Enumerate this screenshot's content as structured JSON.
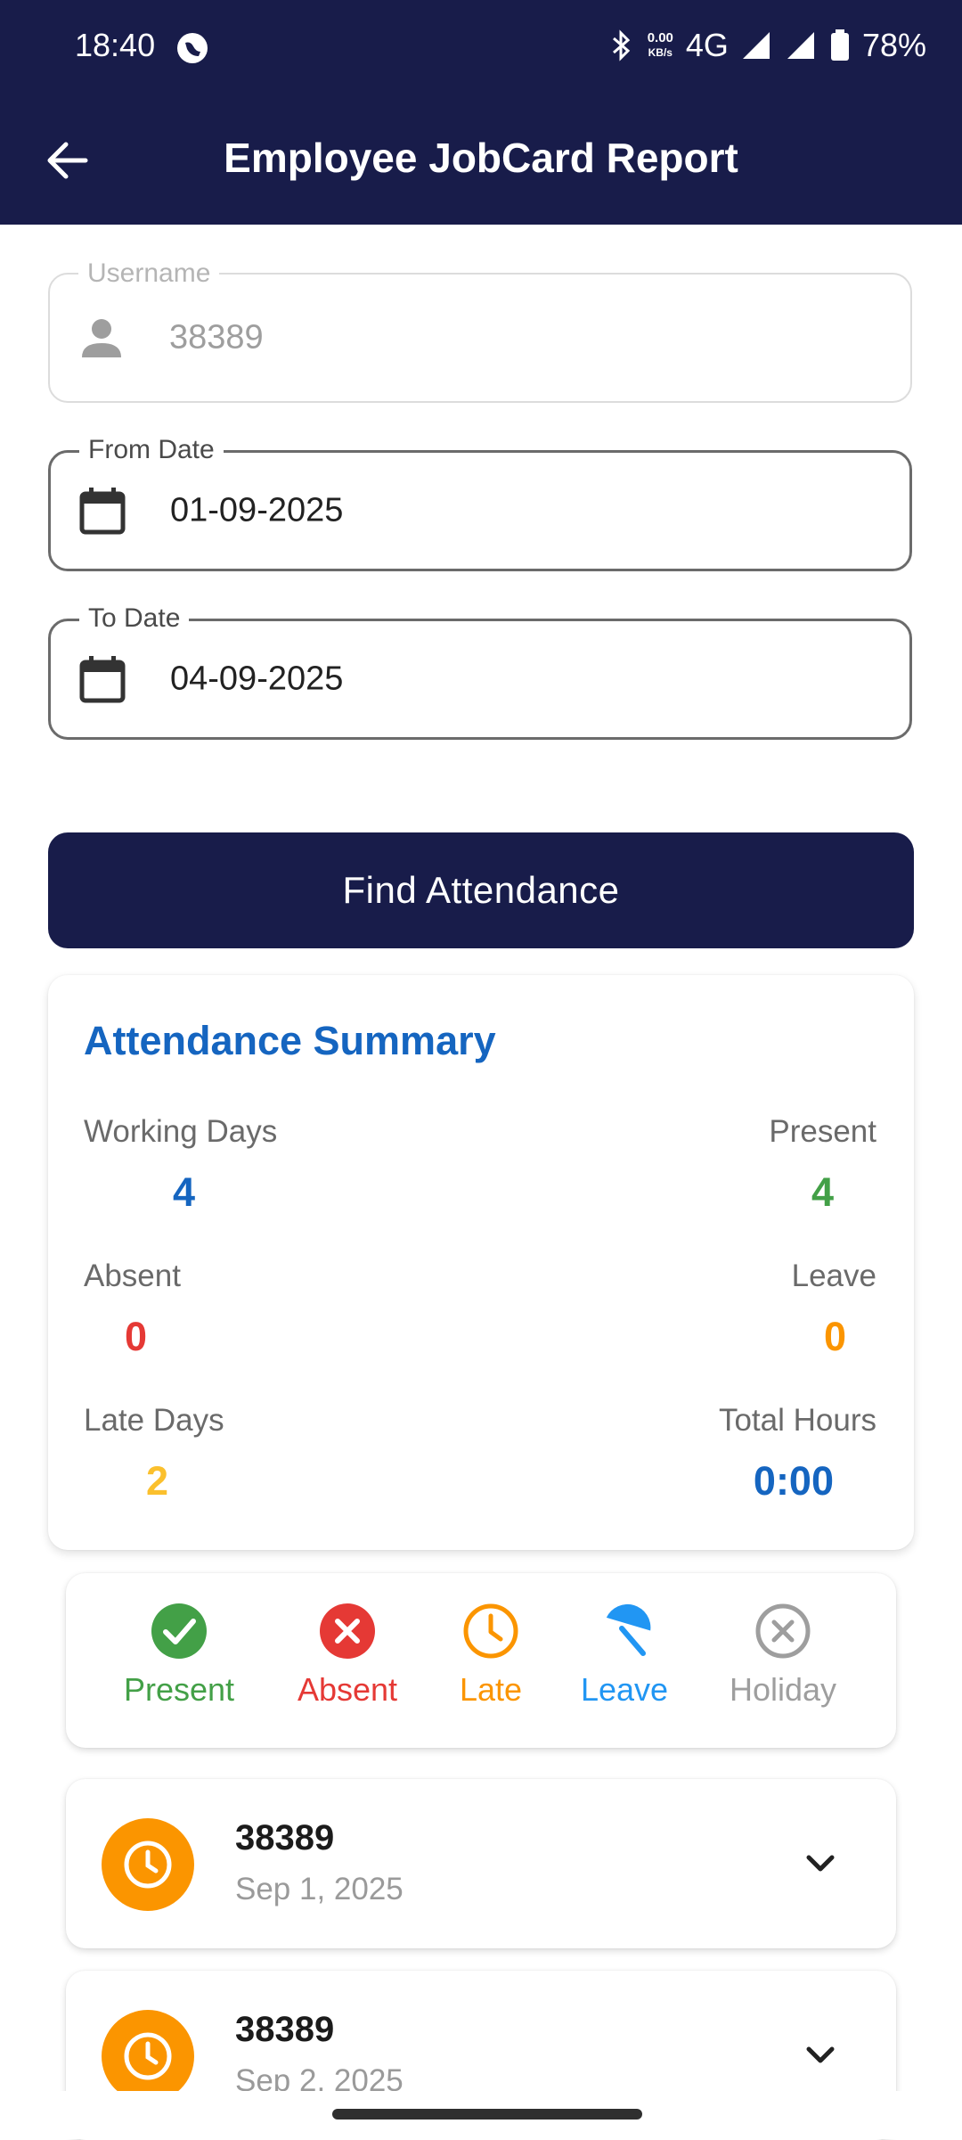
{
  "status_bar": {
    "time": "18:40",
    "speed_top": "0.00",
    "speed_bottom": "KB/s",
    "network": "4G",
    "battery": "78%"
  },
  "app_bar": {
    "title": "Employee JobCard Report",
    "back_icon": "arrow-left-icon"
  },
  "form": {
    "username": {
      "label": "Username",
      "value": "38389",
      "icon": "person-icon"
    },
    "from_date": {
      "label": "From Date",
      "value": "01-09-2025",
      "icon": "calendar-icon"
    },
    "to_date": {
      "label": "To Date",
      "value": "04-09-2025",
      "icon": "calendar-icon"
    },
    "find_button": "Find Attendance"
  },
  "summary": {
    "title": "Attendance Summary",
    "working_days": {
      "label": "Working Days",
      "value": "4"
    },
    "present": {
      "label": "Present",
      "value": "4"
    },
    "absent": {
      "label": "Absent",
      "value": "0"
    },
    "leave": {
      "label": "Leave",
      "value": "0"
    },
    "late_days": {
      "label": "Late Days",
      "value": "2"
    },
    "total_hours": {
      "label": "Total Hours",
      "value": "0:00"
    }
  },
  "legend": [
    {
      "label": "Present",
      "icon": "check-circle-icon",
      "color": "#43a047"
    },
    {
      "label": "Absent",
      "icon": "cancel-circle-icon",
      "color": "#e53935"
    },
    {
      "label": "Late",
      "icon": "clock-icon",
      "color": "#fb9500"
    },
    {
      "label": "Leave",
      "icon": "umbrella-icon",
      "color": "#2196f3"
    },
    {
      "label": "Holiday",
      "icon": "holiday-x-icon",
      "color": "#9e9e9e"
    }
  ],
  "records": [
    {
      "id": "38389",
      "date": "Sep 1, 2025",
      "status_icon": "clock-icon"
    },
    {
      "id": "38389",
      "date": "Sep 2, 2025",
      "status_icon": "clock-icon"
    }
  ],
  "colors": {
    "primary": "#181c4a",
    "summary_title": "#1565c0",
    "present": "#43a047",
    "absent": "#e53935",
    "leave": "#fb9500",
    "late": "#fbc02d",
    "total_hours": "#1565c0"
  }
}
